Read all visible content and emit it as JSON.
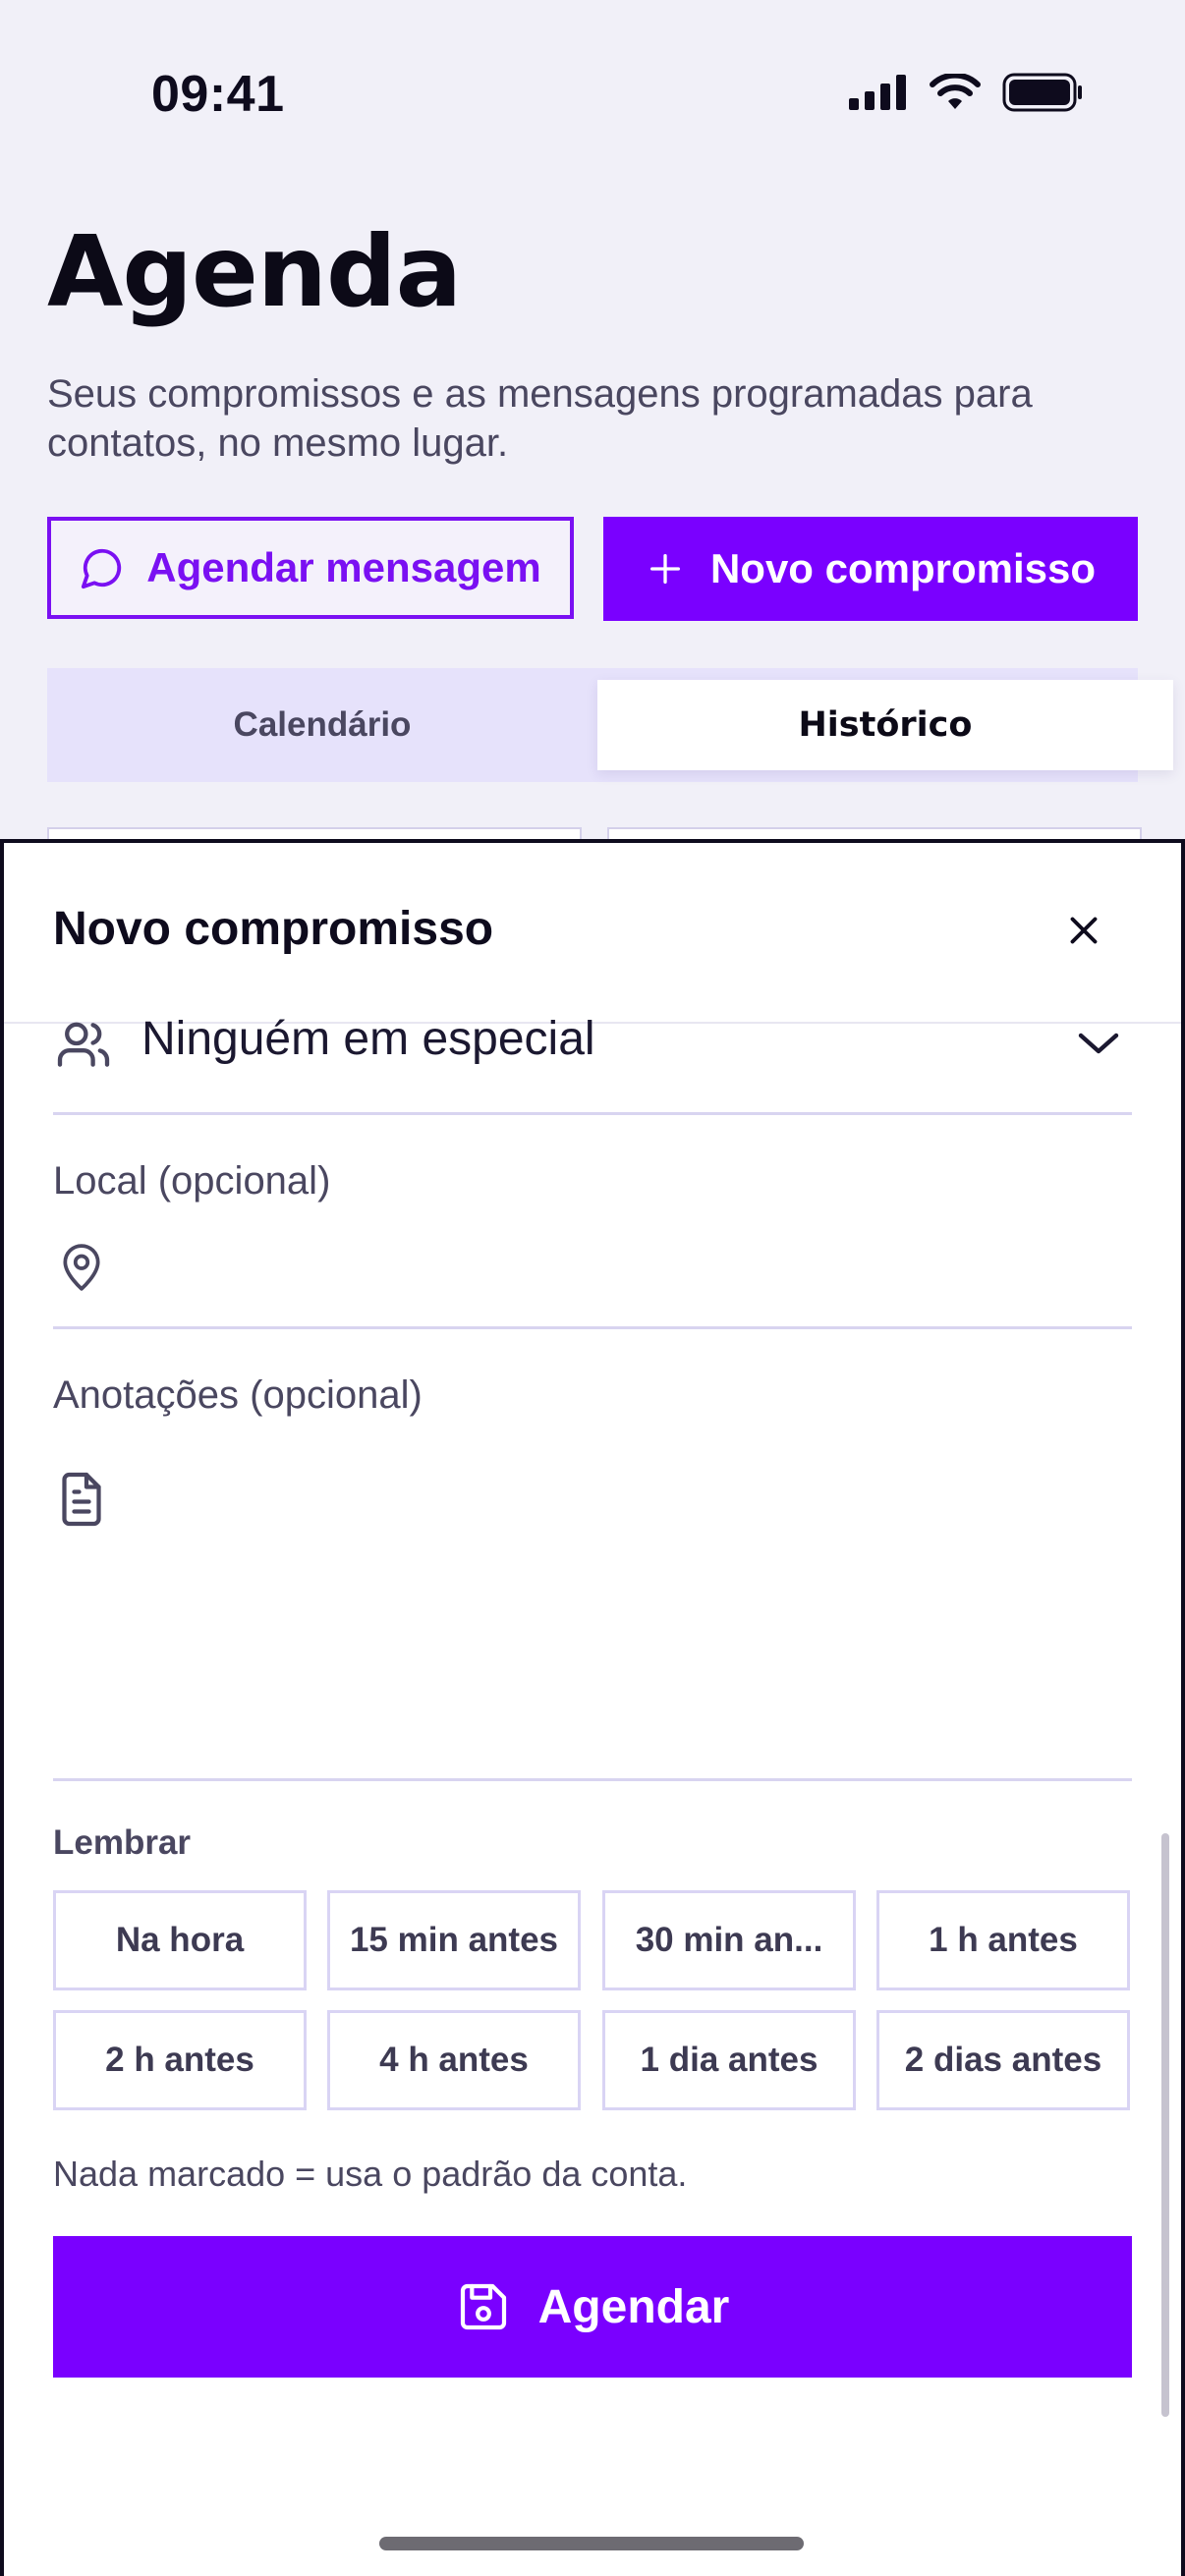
{
  "status_bar": {
    "time": "09:41"
  },
  "header": {
    "title": "Agenda",
    "subtitle": "Seus compromissos e as mensagens programadas para contatos, no mesmo lugar.",
    "schedule_message_label": "Agendar mensagem",
    "new_appointment_label": "Novo compromisso"
  },
  "tabs": [
    {
      "label": "Calendário",
      "selected": false
    },
    {
      "label": "Histórico",
      "selected": true
    }
  ],
  "sheet": {
    "title": "Novo compromisso",
    "participants_value": "Ninguém em especial",
    "location_label": "Local (opcional)",
    "location_value": "",
    "notes_label": "Anotações (opcional)",
    "notes_value": "",
    "remind_label": "Lembrar",
    "remind_options": [
      "Na hora",
      "15 min antes",
      "30 min an...",
      "1 h antes",
      "2 h antes",
      "4 h antes",
      "1 dia antes",
      "2 dias antes"
    ],
    "hint": "Nada marcado = usa o padrão da conta.",
    "submit_label": "Agendar"
  },
  "colors": {
    "accent": "#7a00ff",
    "background": "#f1f0f8",
    "chip_border": "#d9d4f4"
  },
  "icons": [
    "signal-icon",
    "wifi-icon",
    "battery-icon",
    "chat-bubble-icon",
    "plus-icon",
    "close-icon",
    "people-icon",
    "chevron-down-icon",
    "map-pin-icon",
    "document-icon",
    "floppy-disk-icon"
  ]
}
